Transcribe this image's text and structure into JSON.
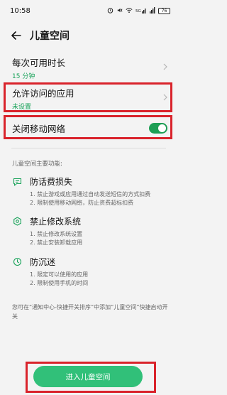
{
  "status_bar": {
    "time": "10:58",
    "network_label": "5G",
    "battery_level": "76"
  },
  "header": {
    "title": "儿童空间"
  },
  "settings": {
    "available_time": {
      "label": "每次可用时长",
      "value": "15 分钟"
    },
    "allowed_apps": {
      "label": "允许访问的应用",
      "value": "未设置"
    },
    "disable_mobile_network": {
      "label": "关闭移动网络",
      "enabled": true
    }
  },
  "features": {
    "section_title": "儿童空间主要功能:",
    "items": [
      {
        "icon": "message-icon",
        "name": "防话费损失",
        "lines": [
          "1. 禁止游戏或应用通过自动发送短信的方式扣费",
          "2. 限制使用移动网络，防止资费超标扣费"
        ]
      },
      {
        "icon": "gear-icon",
        "name": "禁止修改系统",
        "lines": [
          "1. 禁止修改系统设置",
          "2. 禁止安装卸载应用"
        ]
      },
      {
        "icon": "clock-icon",
        "name": "防沉迷",
        "lines": [
          "1. 限定可以使用的应用",
          "2. 限制使用手机的时间"
        ]
      }
    ]
  },
  "note": "您可在“通知中心-快捷开关排序”中添加“儿童空间”快捷启动开关",
  "cta": {
    "label": "进入儿童空间"
  },
  "colors": {
    "accent": "#31c079",
    "highlight": "#d9232b",
    "toggle_on": "#1e9e55"
  }
}
